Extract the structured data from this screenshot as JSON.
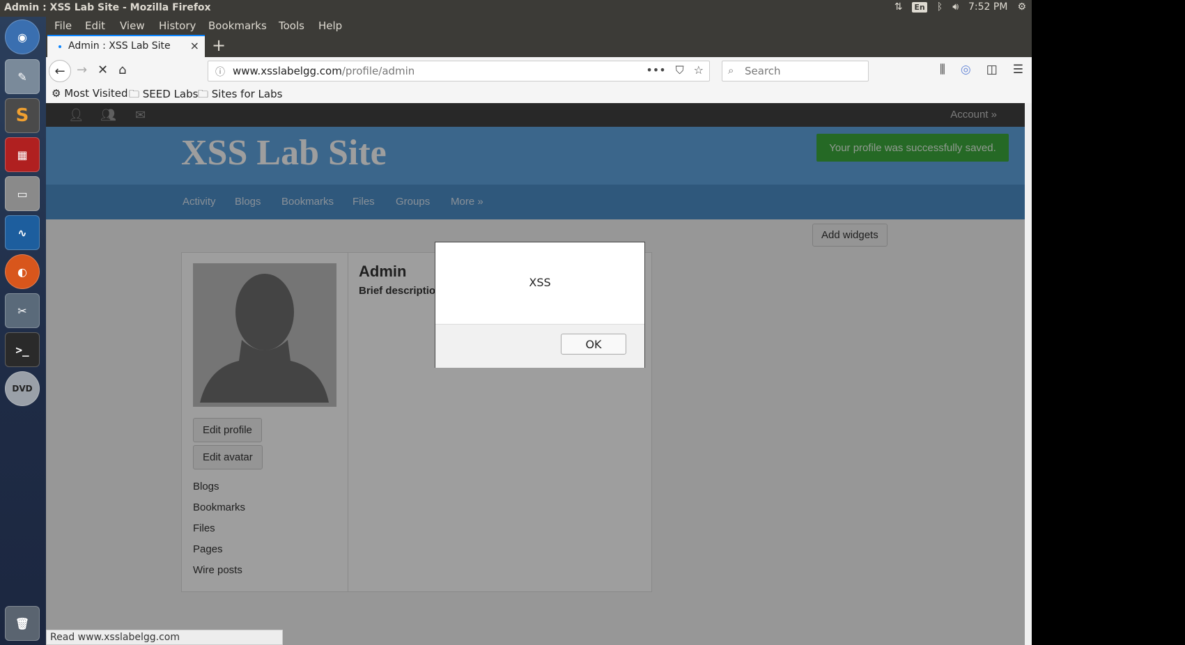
{
  "system": {
    "window_title": "Admin : XSS Lab Site - Mozilla Firefox",
    "keyboard": "En",
    "time": "7:52 PM"
  },
  "launcher": {
    "items": [
      "ubuntu-dash-icon",
      "text-editor-icon",
      "sublime-text-icon",
      "remote-desktop-icon",
      "file-manager-icon",
      "wireshark-icon",
      "firefox-icon",
      "system-settings-icon",
      "terminal-icon",
      "dvd-icon",
      "trash-icon"
    ]
  },
  "menubar": {
    "items": [
      "File",
      "Edit",
      "View",
      "History",
      "Bookmarks",
      "Tools",
      "Help"
    ]
  },
  "tab": {
    "title": "Admin : XSS Lab Site",
    "close": "×",
    "new_tab": "+"
  },
  "navbar": {
    "url_host": "www.xsslabelgg.com",
    "url_path": "/profile/admin",
    "search_placeholder": "Search",
    "page_actions": "•••"
  },
  "bookmarks": {
    "items": [
      "Most Visited",
      "SEED Labs",
      "Sites for Labs"
    ]
  },
  "site": {
    "account": "Account  »",
    "title": "XSS Lab Site",
    "success_message": "Your profile was successfully saved.",
    "nav": [
      "Activity",
      "Blogs",
      "Bookmarks",
      "Files",
      "Groups",
      "More  »"
    ],
    "add_widgets": "Add widgets",
    "profile": {
      "name": "Admin",
      "brief": "Brief description:",
      "edit_profile": "Edit profile",
      "edit_avatar": "Edit avatar",
      "links": [
        "Blogs",
        "Bookmarks",
        "Files",
        "Pages",
        "Wire posts"
      ]
    }
  },
  "status_bar": "Read www.xsslabelgg.com",
  "dialog": {
    "message": "XSS",
    "ok_label": "OK"
  },
  "colors": {
    "header_blue": "#60a5e0",
    "nav_blue": "#4d8ec8",
    "success_green": "#3caa3c",
    "tab_accent": "#0a84ff"
  }
}
